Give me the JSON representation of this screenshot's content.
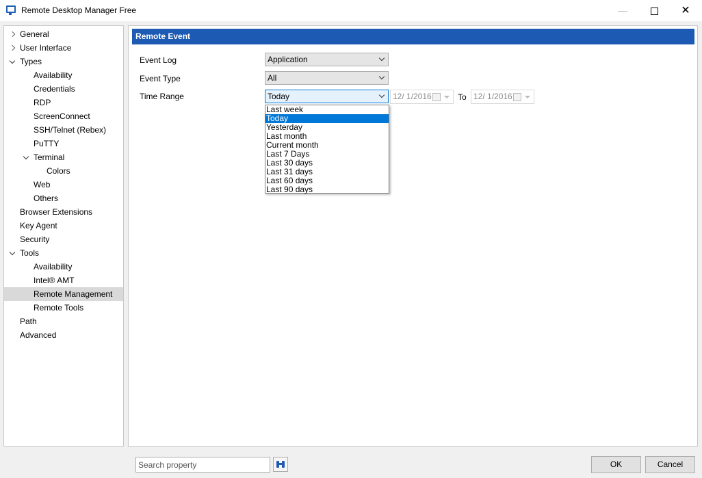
{
  "window": {
    "title": "Remote Desktop Manager Free"
  },
  "sidebar": {
    "items": [
      {
        "label": "General",
        "indent": 0,
        "chevron": "right"
      },
      {
        "label": "User Interface",
        "indent": 0,
        "chevron": "right"
      },
      {
        "label": "Types",
        "indent": 0,
        "chevron": "down"
      },
      {
        "label": "Availability",
        "indent": 1,
        "chevron": ""
      },
      {
        "label": "Credentials",
        "indent": 1,
        "chevron": ""
      },
      {
        "label": "RDP",
        "indent": 1,
        "chevron": ""
      },
      {
        "label": "ScreenConnect",
        "indent": 1,
        "chevron": ""
      },
      {
        "label": "SSH/Telnet (Rebex)",
        "indent": 1,
        "chevron": ""
      },
      {
        "label": "PuTTY",
        "indent": 1,
        "chevron": ""
      },
      {
        "label": "Terminal",
        "indent": 1,
        "chevron": "down"
      },
      {
        "label": "Colors",
        "indent": 2,
        "chevron": ""
      },
      {
        "label": "Web",
        "indent": 1,
        "chevron": ""
      },
      {
        "label": "Others",
        "indent": 1,
        "chevron": ""
      },
      {
        "label": "Browser Extensions",
        "indent": 0,
        "chevron": ""
      },
      {
        "label": "Key Agent",
        "indent": 0,
        "chevron": ""
      },
      {
        "label": "Security",
        "indent": 0,
        "chevron": ""
      },
      {
        "label": "Tools",
        "indent": 0,
        "chevron": "down"
      },
      {
        "label": "Availability",
        "indent": 1,
        "chevron": ""
      },
      {
        "label": "Intel® AMT",
        "indent": 1,
        "chevron": ""
      },
      {
        "label": "Remote Management",
        "indent": 1,
        "chevron": "",
        "selected": true
      },
      {
        "label": "Remote Tools",
        "indent": 1,
        "chevron": ""
      },
      {
        "label": "Path",
        "indent": 0,
        "chevron": ""
      },
      {
        "label": "Advanced",
        "indent": 0,
        "chevron": ""
      }
    ]
  },
  "main": {
    "section_title": "Remote Event",
    "event_log": {
      "label": "Event Log",
      "value": "Application"
    },
    "event_type": {
      "label": "Event Type",
      "value": "All"
    },
    "time_range": {
      "label": "Time Range",
      "value": "Today",
      "options": [
        "Last week",
        "Today",
        "Yesterday",
        "Last month",
        "Current month",
        "Last 7 Days",
        "Last 30 days",
        "Last 31 days",
        "Last 60 days",
        "Last 90 days"
      ],
      "selected_index": 1
    },
    "date_from": "12/  1/2016",
    "to_label": "To",
    "date_to": "12/  1/2016"
  },
  "footer": {
    "search_placeholder": "Search property",
    "ok_label": "OK",
    "cancel_label": "Cancel"
  },
  "colors": {
    "accent": "#1d5ab3",
    "selection": "#0078d7"
  }
}
